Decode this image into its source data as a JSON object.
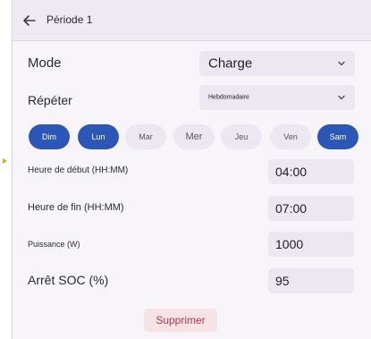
{
  "header": {
    "title": "Période 1",
    "back_icon": "back-arrow-icon"
  },
  "mode": {
    "label": "Mode",
    "value": "Charge"
  },
  "repeat": {
    "label": "Répéter",
    "value": "Hebdomadaire"
  },
  "days": [
    {
      "label": "Dim",
      "selected": true
    },
    {
      "label": "Lun",
      "selected": true
    },
    {
      "label": "Mar",
      "selected": false
    },
    {
      "label": "Mer",
      "selected": false
    },
    {
      "label": "Jeu",
      "selected": false
    },
    {
      "label": "Ven",
      "selected": false
    },
    {
      "label": "Sam",
      "selected": true
    }
  ],
  "fields": {
    "start": {
      "label": "Heure de début (HH:MM)",
      "value": "04:00"
    },
    "end": {
      "label": "Heure de fin (HH:MM)",
      "value": "07:00"
    },
    "power": {
      "label": "Puissance (W)",
      "value": "1000"
    },
    "soc": {
      "label": "Arrêt SOC (%)",
      "value": "95"
    }
  },
  "actions": {
    "delete_label": "Supprimer"
  },
  "colors": {
    "accent": "#2d57b6",
    "danger_text": "#b13a4a",
    "danger_bg": "#f6e3e5",
    "marker": "#e8a13a"
  }
}
